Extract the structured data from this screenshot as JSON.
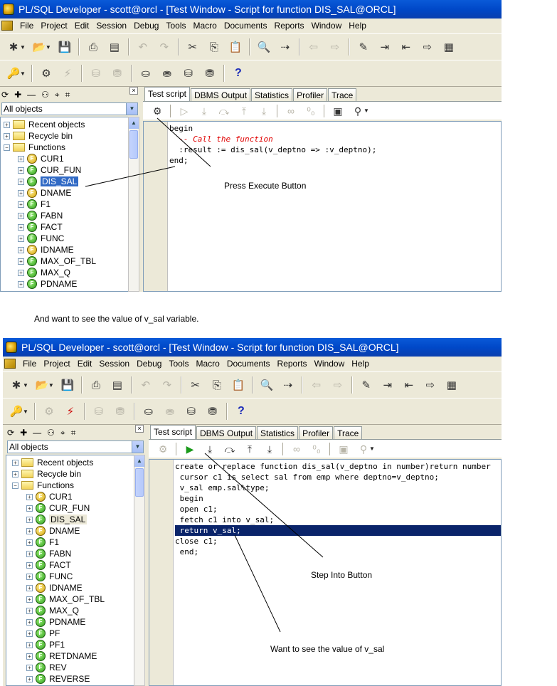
{
  "window": {
    "title": "PL/SQL Developer - scott@orcl - [Test Window - Script for function DIS_SAL@ORCL]"
  },
  "menu": [
    "File",
    "Project",
    "Edit",
    "Session",
    "Debug",
    "Tools",
    "Macro",
    "Documents",
    "Reports",
    "Window",
    "Help"
  ],
  "object_browser": {
    "filter": "All objects",
    "folders": [
      "Recent objects",
      "Recycle bin",
      "Functions"
    ],
    "functions_top": [
      "CUR1",
      "CUR_FUN",
      "DIS_SAL",
      "DNAME",
      "F1",
      "FABN",
      "FACT",
      "FUNC",
      "IDNAME",
      "MAX_OF_TBL",
      "MAX_Q",
      "PDNAME"
    ],
    "functions_bottom": [
      "CUR1",
      "CUR_FUN",
      "DIS_SAL",
      "DNAME",
      "F1",
      "FABN",
      "FACT",
      "FUNC",
      "IDNAME",
      "MAX_OF_TBL",
      "MAX_Q",
      "PDNAME",
      "PF",
      "PF1",
      "RETDNAME",
      "REV",
      "REVERSE"
    ],
    "selected": "DIS_SAL"
  },
  "tabs": [
    "Test script",
    "DBMS Output",
    "Statistics",
    "Profiler",
    "Trace"
  ],
  "script_top": [
    "begin",
    "  -- Call the function",
    "  :result := dis_sal(v_deptno => :v_deptno);",
    "end;"
  ],
  "script_bottom": [
    "create or replace function dis_sal(v_deptno in number)return number",
    " cursor c1 is select sal from emp where deptno=v_deptno;",
    " v_sal emp.sal%type;",
    " begin",
    " open c1;",
    " fetch c1 into v_sal;",
    " return v_sal;",
    "close c1;",
    " end;"
  ],
  "captions": {
    "press_execute": "Press Execute Button",
    "want_value": "And want to see the value of v_sal variable.",
    "step_into": "Step Into Button",
    "want_value_2": "Want to see the value of v_sal"
  },
  "help_label": "?"
}
